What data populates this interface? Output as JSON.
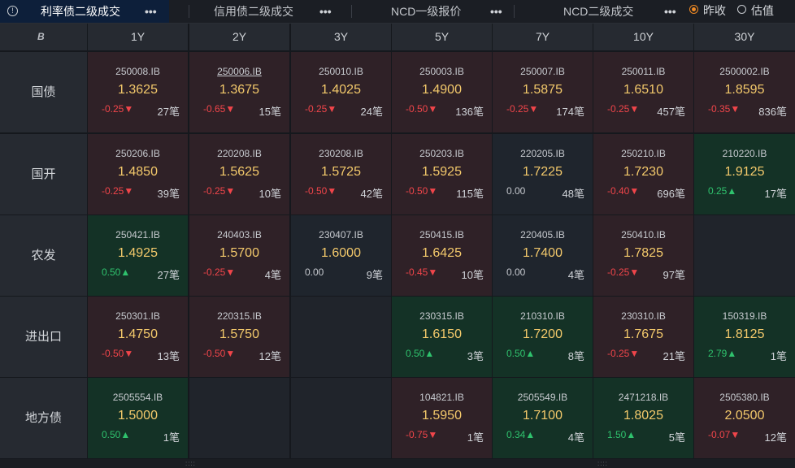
{
  "tabs": [
    {
      "label": "利率债二级成交",
      "active": true
    },
    {
      "label": "信用债二级成交",
      "active": false
    },
    {
      "label": "NCD一级报价",
      "active": false
    },
    {
      "label": "NCD二级成交",
      "active": false
    }
  ],
  "more_glyph": "•••",
  "info_glyph": "!",
  "radio": {
    "selected": "昨收",
    "options": [
      "昨收",
      "估值"
    ]
  },
  "logo_glyph": "B",
  "columns": [
    "1Y",
    "2Y",
    "3Y",
    "5Y",
    "7Y",
    "10Y",
    "30Y"
  ],
  "rows": [
    {
      "name": "国债",
      "cells": [
        {
          "code": "250008.IB",
          "price": "1.3625",
          "chg": "-0.25▼",
          "dir": "down",
          "count": "27笔",
          "tone": "red",
          "underline": false
        },
        {
          "code": "250006.IB",
          "price": "1.3675",
          "chg": "-0.65▼",
          "dir": "down",
          "count": "15笔",
          "tone": "red",
          "underline": true
        },
        {
          "code": "250010.IB",
          "price": "1.4025",
          "chg": "-0.25▼",
          "dir": "down",
          "count": "24笔",
          "tone": "red",
          "underline": false
        },
        {
          "code": "250003.IB",
          "price": "1.4900",
          "chg": "-0.50▼",
          "dir": "down",
          "count": "136笔",
          "tone": "red",
          "underline": false
        },
        {
          "code": "250007.IB",
          "price": "1.5875",
          "chg": "-0.25▼",
          "dir": "down",
          "count": "174笔",
          "tone": "red",
          "underline": false
        },
        {
          "code": "250011.IB",
          "price": "1.6510",
          "chg": "-0.25▼",
          "dir": "down",
          "count": "457笔",
          "tone": "red",
          "underline": false
        },
        {
          "code": "2500002.IB",
          "price": "1.8595",
          "chg": "-0.35▼",
          "dir": "down",
          "count": "836笔",
          "tone": "red",
          "underline": false
        }
      ]
    },
    {
      "name": "国开",
      "cells": [
        {
          "code": "250206.IB",
          "price": "1.4850",
          "chg": "-0.25▼",
          "dir": "down",
          "count": "39笔",
          "tone": "red",
          "underline": false
        },
        {
          "code": "220208.IB",
          "price": "1.5625",
          "chg": "-0.25▼",
          "dir": "down",
          "count": "10笔",
          "tone": "red",
          "underline": false
        },
        {
          "code": "230208.IB",
          "price": "1.5725",
          "chg": "-0.50▼",
          "dir": "down",
          "count": "42笔",
          "tone": "red",
          "underline": false
        },
        {
          "code": "250203.IB",
          "price": "1.5925",
          "chg": "-0.50▼",
          "dir": "down",
          "count": "115笔",
          "tone": "red",
          "underline": false
        },
        {
          "code": "220205.IB",
          "price": "1.7225",
          "chg": "0.00",
          "dir": "flat",
          "count": "48笔",
          "tone": "neutral",
          "underline": false
        },
        {
          "code": "250210.IB",
          "price": "1.7230",
          "chg": "-0.40▼",
          "dir": "down",
          "count": "696笔",
          "tone": "red",
          "underline": false
        },
        {
          "code": "210220.IB",
          "price": "1.9125",
          "chg": "0.25▲",
          "dir": "up",
          "count": "17笔",
          "tone": "green",
          "underline": false
        }
      ]
    },
    {
      "name": "农发",
      "cells": [
        {
          "code": "250421.IB",
          "price": "1.4925",
          "chg": "0.50▲",
          "dir": "up",
          "count": "27笔",
          "tone": "green",
          "underline": false
        },
        {
          "code": "240403.IB",
          "price": "1.5700",
          "chg": "-0.25▼",
          "dir": "down",
          "count": "4笔",
          "tone": "red",
          "underline": false
        },
        {
          "code": "230407.IB",
          "price": "1.6000",
          "chg": "0.00",
          "dir": "flat",
          "count": "9笔",
          "tone": "neutral",
          "underline": false
        },
        {
          "code": "250415.IB",
          "price": "1.6425",
          "chg": "-0.45▼",
          "dir": "down",
          "count": "10笔",
          "tone": "red",
          "underline": false
        },
        {
          "code": "220405.IB",
          "price": "1.7400",
          "chg": "0.00",
          "dir": "flat",
          "count": "4笔",
          "tone": "neutral",
          "underline": false
        },
        {
          "code": "250410.IB",
          "price": "1.7825",
          "chg": "-0.25▼",
          "dir": "down",
          "count": "97笔",
          "tone": "red",
          "underline": false
        },
        null
      ]
    },
    {
      "name": "进出口",
      "cells": [
        {
          "code": "250301.IB",
          "price": "1.4750",
          "chg": "-0.50▼",
          "dir": "down",
          "count": "13笔",
          "tone": "red",
          "underline": false
        },
        {
          "code": "220315.IB",
          "price": "1.5750",
          "chg": "-0.50▼",
          "dir": "down",
          "count": "12笔",
          "tone": "red",
          "underline": false
        },
        null,
        {
          "code": "230315.IB",
          "price": "1.6150",
          "chg": "0.50▲",
          "dir": "up",
          "count": "3笔",
          "tone": "green",
          "underline": false
        },
        {
          "code": "210310.IB",
          "price": "1.7200",
          "chg": "0.50▲",
          "dir": "up",
          "count": "8笔",
          "tone": "green",
          "underline": false
        },
        {
          "code": "230310.IB",
          "price": "1.7675",
          "chg": "-0.25▼",
          "dir": "down",
          "count": "21笔",
          "tone": "red",
          "underline": false
        },
        {
          "code": "150319.IB",
          "price": "1.8125",
          "chg": "2.79▲",
          "dir": "up",
          "count": "1笔",
          "tone": "green",
          "underline": false
        }
      ]
    },
    {
      "name": "地方债",
      "cells": [
        {
          "code": "2505554.IB",
          "price": "1.5000",
          "chg": "0.50▲",
          "dir": "up",
          "count": "1笔",
          "tone": "green",
          "underline": false
        },
        null,
        null,
        {
          "code": "104821.IB",
          "price": "1.5950",
          "chg": "-0.75▼",
          "dir": "down",
          "count": "1笔",
          "tone": "red",
          "underline": false
        },
        {
          "code": "2505549.IB",
          "price": "1.7100",
          "chg": "0.34▲",
          "dir": "up",
          "count": "4笔",
          "tone": "green",
          "underline": false
        },
        {
          "code": "2471218.IB",
          "price": "1.8025",
          "chg": "1.50▲",
          "dir": "up",
          "count": "5笔",
          "tone": "green",
          "underline": false
        },
        {
          "code": "2505380.IB",
          "price": "2.0500",
          "chg": "-0.07▼",
          "dir": "down",
          "count": "12笔",
          "tone": "red",
          "underline": false
        }
      ]
    }
  ]
}
